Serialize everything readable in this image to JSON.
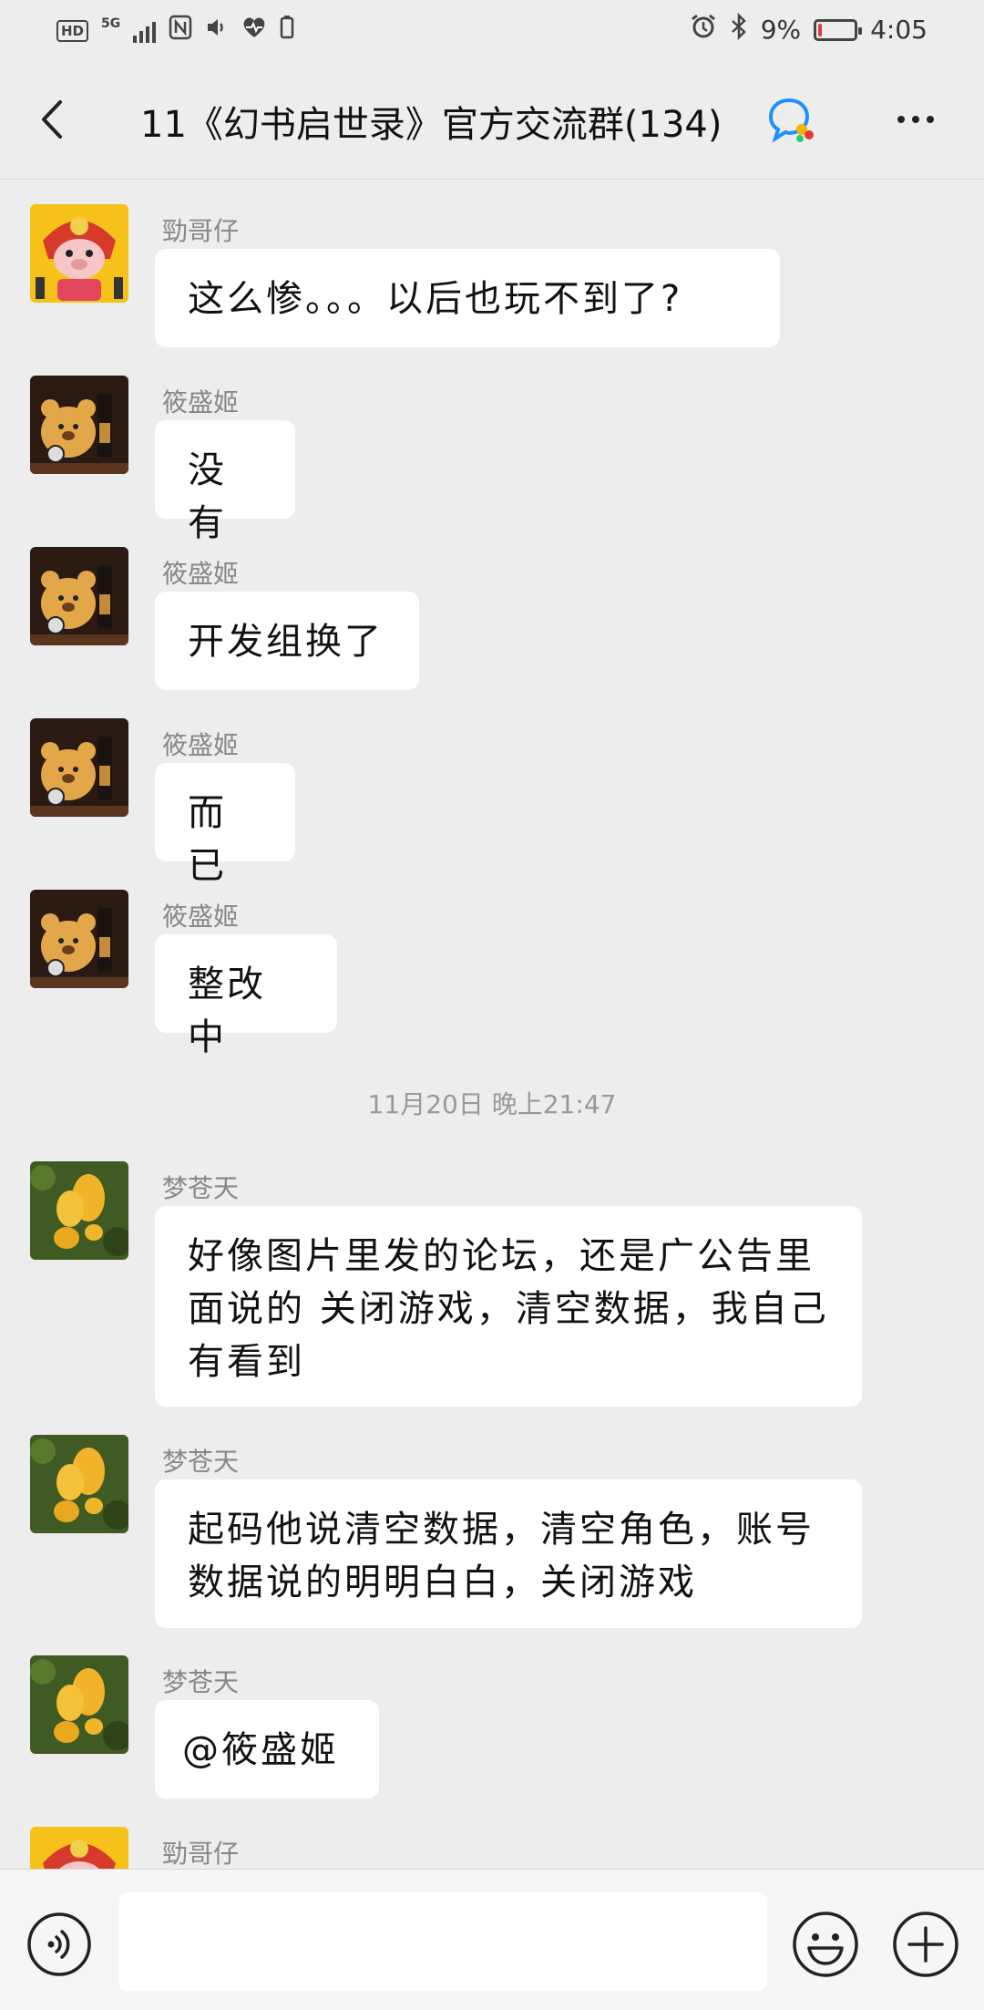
{
  "status_bar": {
    "network": "5G",
    "hd_label": "HD",
    "battery": "9%",
    "battery_level": 0.09,
    "time": "4:05"
  },
  "header": {
    "title": "11《幻书启世录》官方交流群(134)"
  },
  "messages": [
    {
      "sender": "勁哥仔",
      "avatar": "lion-dance-pig",
      "text": "这么惨。。。以后也玩不到了?"
    },
    {
      "sender": "筱盛姬",
      "avatar": "teddy-bear",
      "text": "没有"
    },
    {
      "sender": "筱盛姬",
      "avatar": "teddy-bear",
      "text": "开发组换了"
    },
    {
      "sender": "筱盛姬",
      "avatar": "teddy-bear",
      "text": "而已"
    },
    {
      "sender": "筱盛姬",
      "avatar": "teddy-bear",
      "text": "整改中"
    },
    {
      "sender": "梦苍天",
      "avatar": "yellow-fruit",
      "text": "好像图片里发的论坛，还是广公告里面说的 关闭游戏，清空数据，我自己有看到"
    },
    {
      "sender": "梦苍天",
      "avatar": "yellow-fruit",
      "text": "起码他说清空数据，清空角色，账号数据说的明明白白，关闭游戏"
    },
    {
      "sender": "梦苍天",
      "avatar": "yellow-fruit",
      "text": "@筱盛姬"
    },
    {
      "sender": "勁哥仔",
      "avatar": "lion-dance-pig",
      "text": ""
    }
  ],
  "timestamp_divider": "11月20日 晚上21:47",
  "input": {
    "placeholder": ""
  },
  "colors": {
    "background": "#ededed",
    "bubble": "#ffffff",
    "battery_low": "#e53935",
    "qq_blue": "#1e90ff"
  }
}
